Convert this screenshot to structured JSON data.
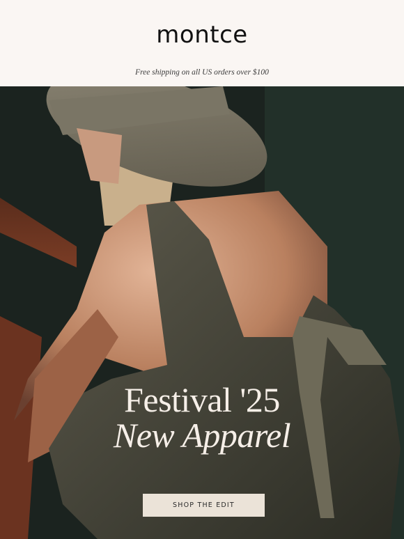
{
  "brand": {
    "logo_text": "montce"
  },
  "promo_bar": {
    "text": "Free shipping on all US orders over $100"
  },
  "hero": {
    "headline_line1": "Festival '25",
    "headline_line2": "New Apparel",
    "cta_label": "SHOP THE EDIT",
    "image_description_icon": "photo-woman-bucket-hat-apron-dress"
  },
  "colors": {
    "background": "#faf6f3",
    "hero_dark": "#1c2420",
    "headline": "#f6efe8",
    "cta_bg": "#ebe3d8",
    "cta_text": "#2a2a2a"
  }
}
